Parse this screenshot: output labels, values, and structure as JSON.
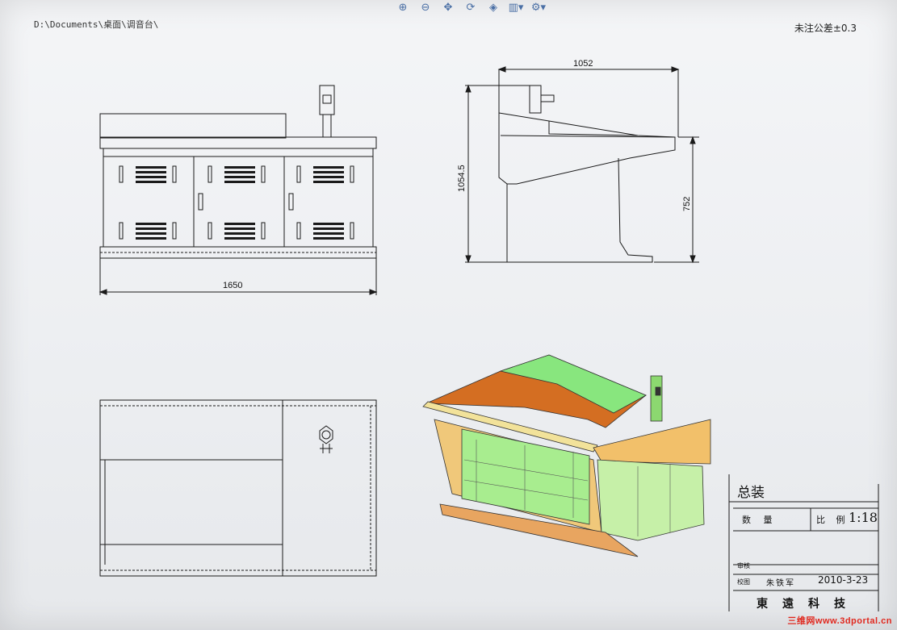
{
  "path": "D:\\Documents\\桌面\\调音台\\",
  "tolerance_note": "未注公差±0.3",
  "toolbar": {
    "buttons": [
      {
        "icon": "zoom-in-icon"
      },
      {
        "icon": "zoom-out-icon"
      },
      {
        "icon": "pan-icon"
      },
      {
        "icon": "rotate-icon"
      },
      {
        "icon": "view-orientation-icon"
      },
      {
        "icon": "display-style-icon"
      },
      {
        "icon": "view-settings-icon"
      }
    ]
  },
  "dimensions": {
    "front_width": "1650",
    "side_depth": "1052",
    "side_total_height": "1054.5",
    "side_table_height": "752"
  },
  "title_block": {
    "title": "总装",
    "quantity_label": "数 量",
    "ratio_label": "比 例",
    "ratio_value": "1:18",
    "review_label": "审核",
    "check_label": "校图",
    "drafter": "朱铁军",
    "date": "2010-3-23",
    "company": "東遠科技"
  },
  "watermark": "三维网www.3dportal.cn",
  "colors": {
    "line": "#1a1a1a",
    "iso_green": "#7fe07a",
    "iso_orange": "#e39a3a",
    "iso_brown": "#c9702a",
    "iso_yellow": "#f2d08a"
  }
}
